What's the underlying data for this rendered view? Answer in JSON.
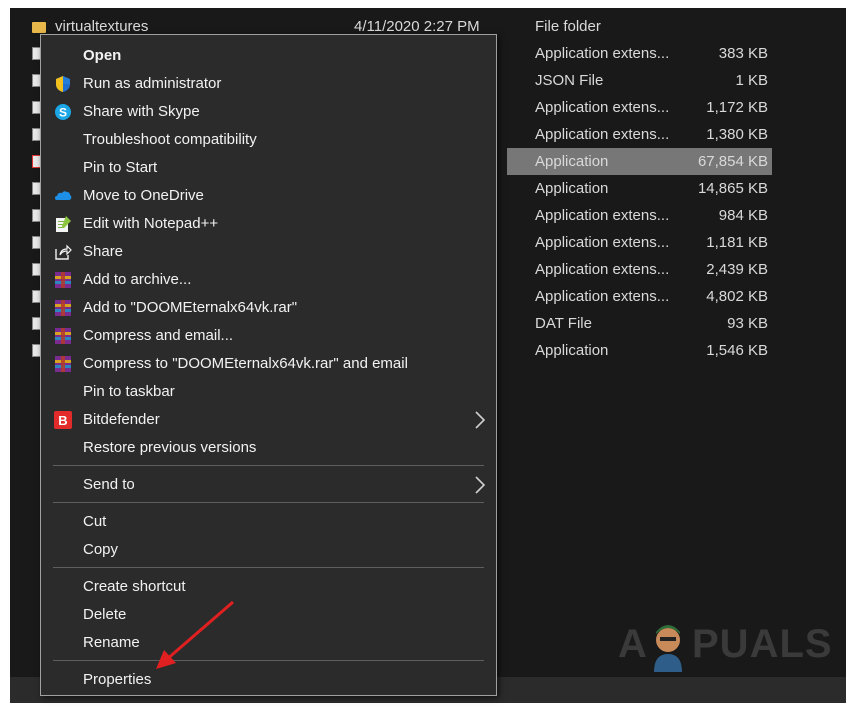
{
  "files": [
    {
      "name": "virtualtextures",
      "date": "4/11/2020 2:27 PM",
      "type": "File folder",
      "size": "",
      "icon": "folder-icon"
    },
    {
      "name": "",
      "date": "",
      "type": "Application extens...",
      "size": "383 KB",
      "icon": "dll-file-icon"
    },
    {
      "name": "",
      "date": "",
      "type": "JSON File",
      "size": "1 KB",
      "icon": "json-file-icon"
    },
    {
      "name": "",
      "date": "",
      "type": "Application extens...",
      "size": "1,172 KB",
      "icon": "dll-file-icon"
    },
    {
      "name": "",
      "date": "",
      "type": "Application extens...",
      "size": "1,380 KB",
      "icon": "dll-file-icon"
    },
    {
      "name": "",
      "date": "",
      "type": "Application",
      "size": "67,854 KB",
      "icon": "exe-file-icon",
      "selected": true
    },
    {
      "name": "",
      "date": "",
      "type": "Application",
      "size": "14,865 KB",
      "icon": "exe-file-icon"
    },
    {
      "name": "",
      "date": "",
      "type": "Application extens...",
      "size": "984 KB",
      "icon": "dll-file-icon"
    },
    {
      "name": "",
      "date": "",
      "type": "Application extens...",
      "size": "1,181 KB",
      "icon": "dll-file-icon"
    },
    {
      "name": "",
      "date": "",
      "type": "Application extens...",
      "size": "2,439 KB",
      "icon": "dll-file-icon"
    },
    {
      "name": "",
      "date": "",
      "type": "Application extens...",
      "size": "4,802 KB",
      "icon": "dll-file-icon"
    },
    {
      "name": "",
      "date": "",
      "type": "DAT File",
      "size": "93 KB",
      "icon": "dat-file-icon"
    },
    {
      "name": "",
      "date": "",
      "type": "Application",
      "size": "1,546 KB",
      "icon": "exe-file-icon"
    }
  ],
  "context_menu": {
    "groups": [
      [
        {
          "label": "Open",
          "bold": true,
          "icon": ""
        },
        {
          "label": "Run as administrator",
          "icon": "uac-shield-icon"
        },
        {
          "label": "Share with Skype",
          "icon": "skype-icon"
        },
        {
          "label": "Troubleshoot compatibility",
          "icon": ""
        },
        {
          "label": "Pin to Start",
          "icon": ""
        },
        {
          "label": "Move to OneDrive",
          "icon": "onedrive-icon"
        },
        {
          "label": "Edit with Notepad++",
          "icon": "notepad-plus-plus-icon"
        },
        {
          "label": "Share",
          "icon": "share-icon"
        },
        {
          "label": "Add to archive...",
          "icon": "winrar-icon"
        },
        {
          "label": "Add to \"DOOMEternalx64vk.rar\"",
          "icon": "winrar-icon"
        },
        {
          "label": "Compress and email...",
          "icon": "winrar-icon"
        },
        {
          "label": "Compress to \"DOOMEternalx64vk.rar\" and email",
          "icon": "winrar-icon"
        },
        {
          "label": "Pin to taskbar",
          "icon": ""
        },
        {
          "label": "Bitdefender",
          "icon": "bitdefender-icon",
          "submenu": true
        },
        {
          "label": "Restore previous versions",
          "icon": ""
        }
      ],
      [
        {
          "label": "Send to",
          "icon": "",
          "submenu": true
        }
      ],
      [
        {
          "label": "Cut",
          "icon": ""
        },
        {
          "label": "Copy",
          "icon": ""
        }
      ],
      [
        {
          "label": "Create shortcut",
          "icon": ""
        },
        {
          "label": "Delete",
          "icon": ""
        },
        {
          "label": "Rename",
          "icon": ""
        }
      ],
      [
        {
          "label": "Properties",
          "icon": ""
        }
      ]
    ]
  },
  "annotation": {
    "arrow_color": "#e02020",
    "points_to": "Properties"
  },
  "watermark": {
    "text_left": "A",
    "text_right": "PUALS"
  },
  "colors": {
    "menu_bg": "#2b2b2b",
    "explorer_bg": "#191919",
    "selection": "#777777",
    "text": "#f2f2f2",
    "arrow": "#e02020"
  }
}
